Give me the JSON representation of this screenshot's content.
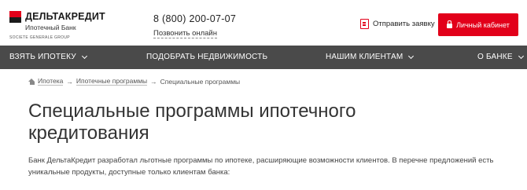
{
  "header": {
    "logo": {
      "name": "ДЕЛЬТАКРЕДИТ",
      "subtitle": "Ипотечный Банк",
      "group": "SOCIETE GENERALE GROUP"
    },
    "phone": "8 (800) 200-07-07",
    "callback_label": "Позвонить онлайн",
    "apply_label": "Отправить заявку",
    "cabinet_label": "Личный кабинет"
  },
  "nav": {
    "items": [
      {
        "label": "ВЗЯТЬ ИПОТЕКУ"
      },
      {
        "label": "ПОДОБРАТЬ НЕДВИЖИМОСТЬ"
      },
      {
        "label": "НАШИМ КЛИЕНТАМ"
      },
      {
        "label": "О БАНКЕ"
      }
    ]
  },
  "breadcrumb": {
    "items": [
      "Ипотека",
      "Ипотечные программы"
    ],
    "separator": "→",
    "current": "Специальные программы"
  },
  "page": {
    "title": "Специальные программы ипотечного кредитования",
    "intro": "Банк ДельтаКредит разработал льготные программы по ипотеке, расширяющие возможности клиентов. В перечне предложений есть уникальные продукты, доступные только клиентам банка:"
  },
  "colors": {
    "brand_red": "#e2001a",
    "nav_bg": "#4a4a4a"
  }
}
